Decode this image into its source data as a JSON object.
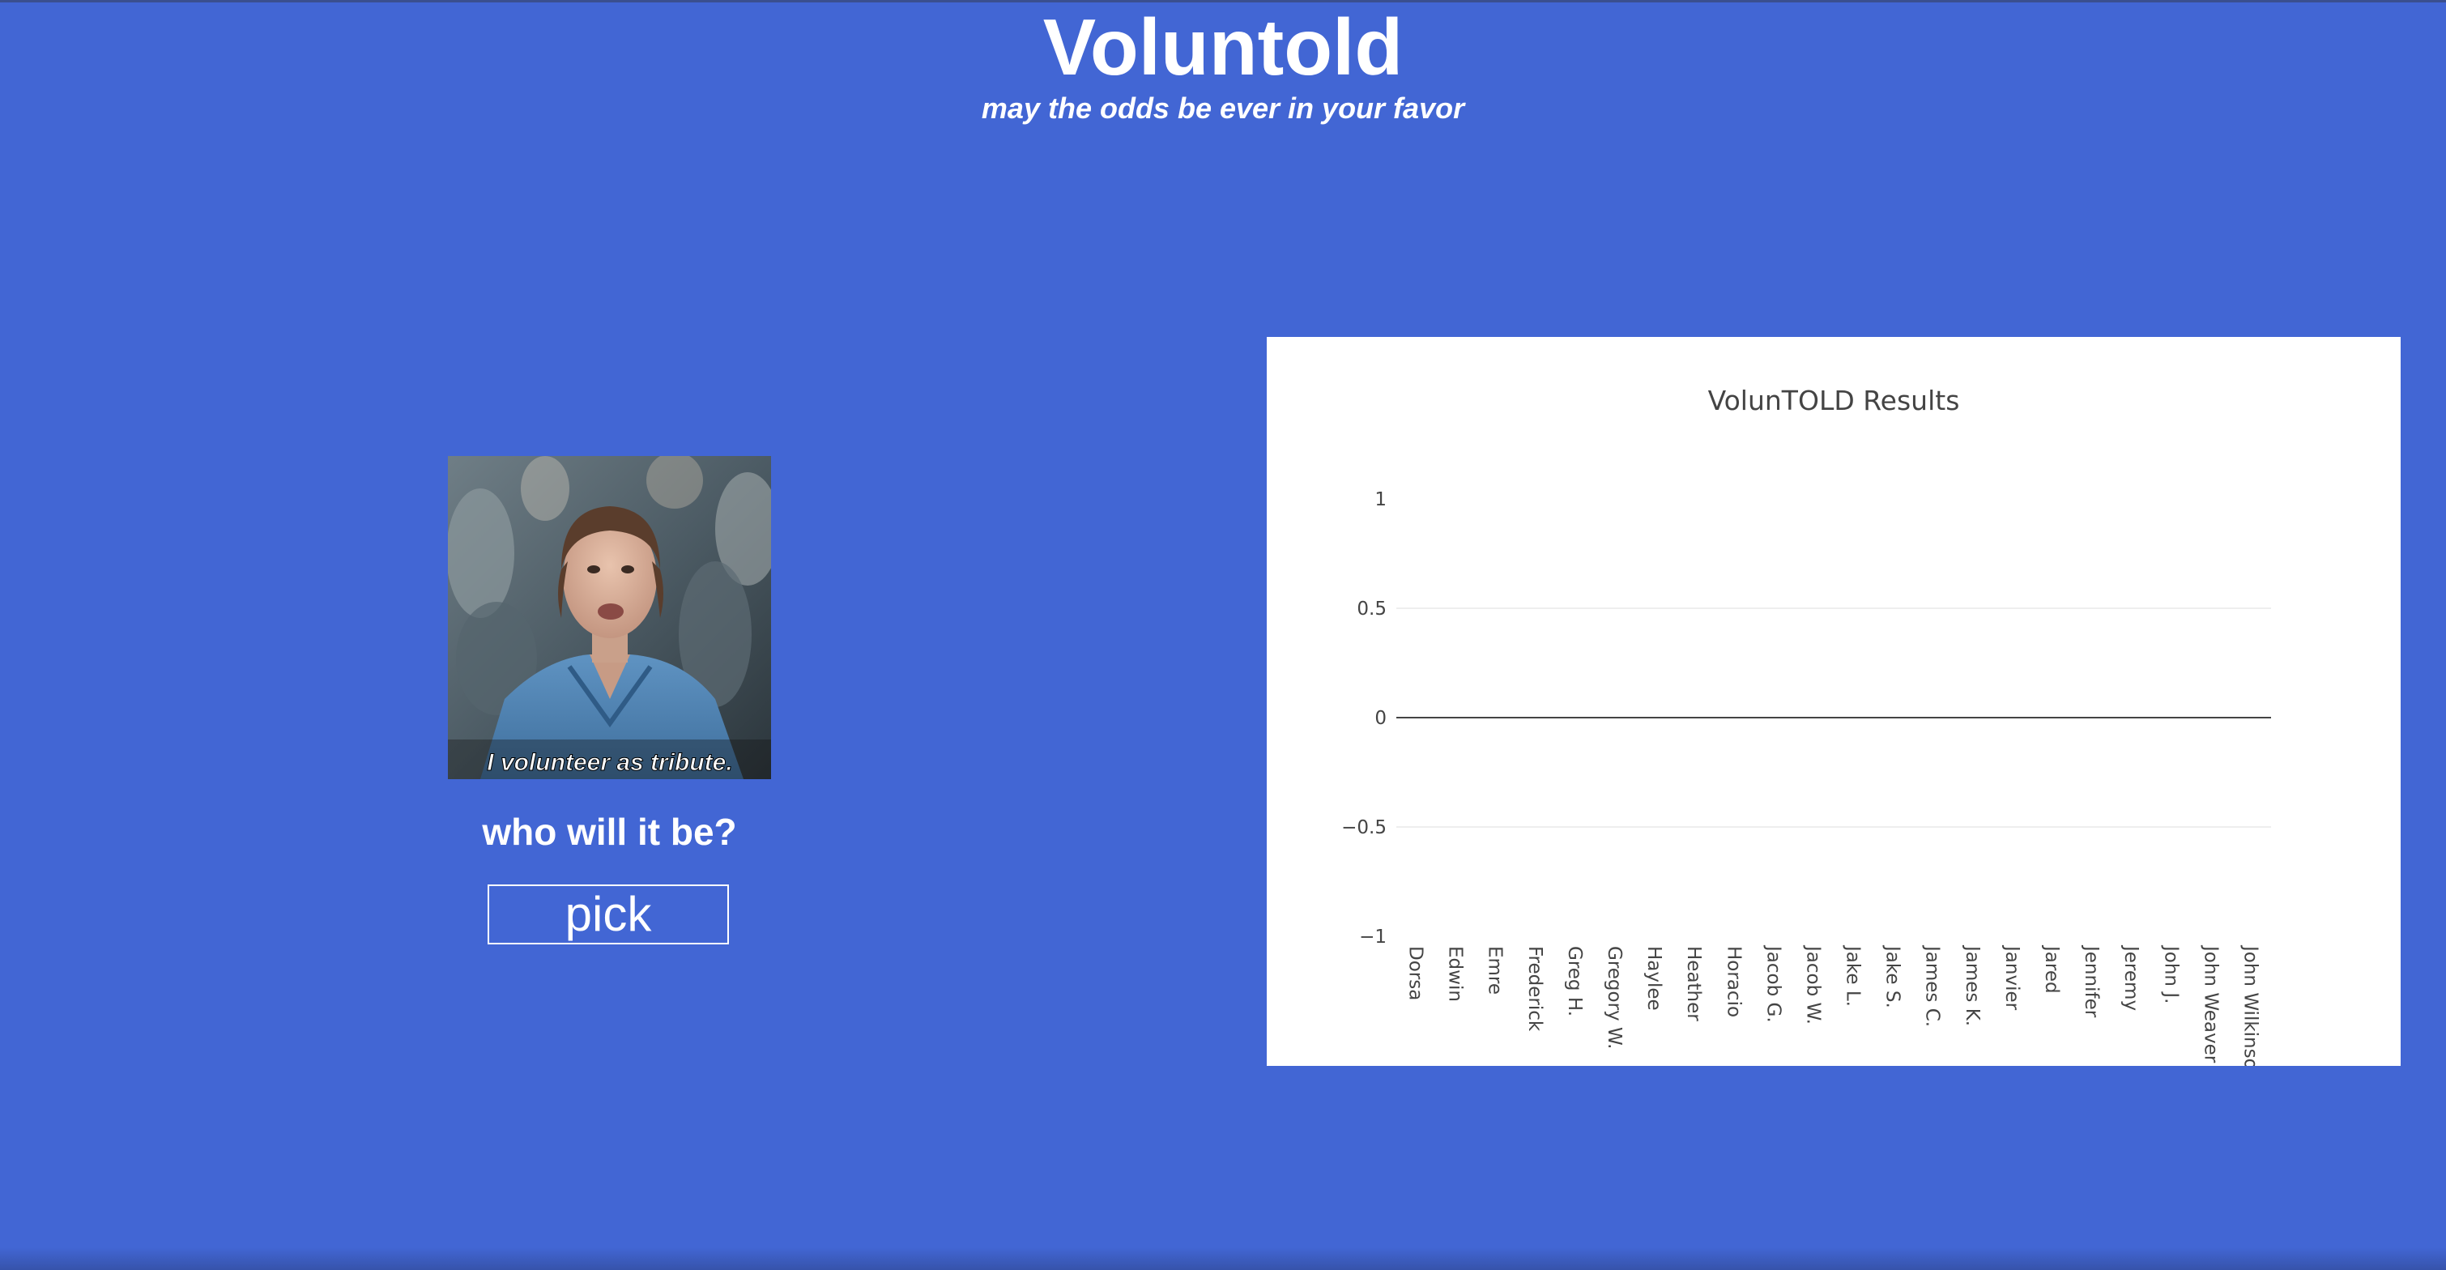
{
  "header": {
    "title": "Voluntold",
    "subtitle": "may the odds be ever in your favor"
  },
  "hero": {
    "image_caption": "I volunteer as tribute.",
    "prompt": "who will it be?",
    "pick_label": "pick"
  },
  "colors": {
    "background": "#4266d4",
    "text": "#ffffff",
    "chart_background": "#ffffff",
    "zero_line": "#444444",
    "grid": "#eeeeee"
  },
  "chart_data": {
    "type": "bar",
    "title": "VolunTOLD Results",
    "xlabel": "",
    "ylabel": "",
    "ylim": [
      -1,
      1
    ],
    "yticks": [
      1,
      0.5,
      0,
      -0.5,
      -1
    ],
    "ytick_labels": [
      "1",
      "0.5",
      "0",
      "−0.5",
      "−1"
    ],
    "grid": true,
    "categories": [
      "Dorsa",
      "Edwin",
      "Emre",
      "Frederick",
      "Greg H.",
      "Gregory W.",
      "Haylee",
      "Heather",
      "Horacio",
      "Jacob G.",
      "Jacob W.",
      "Jake L.",
      "Jake S.",
      "James C.",
      "James K.",
      "Janvier",
      "Jared",
      "Jennifer",
      "Jeremy",
      "John J.",
      "John Weaver",
      "John Wilkinson"
    ],
    "values": [
      0,
      0,
      0,
      0,
      0,
      0,
      0,
      0,
      0,
      0,
      0,
      0,
      0,
      0,
      0,
      0,
      0,
      0,
      0,
      0,
      0,
      0
    ]
  }
}
